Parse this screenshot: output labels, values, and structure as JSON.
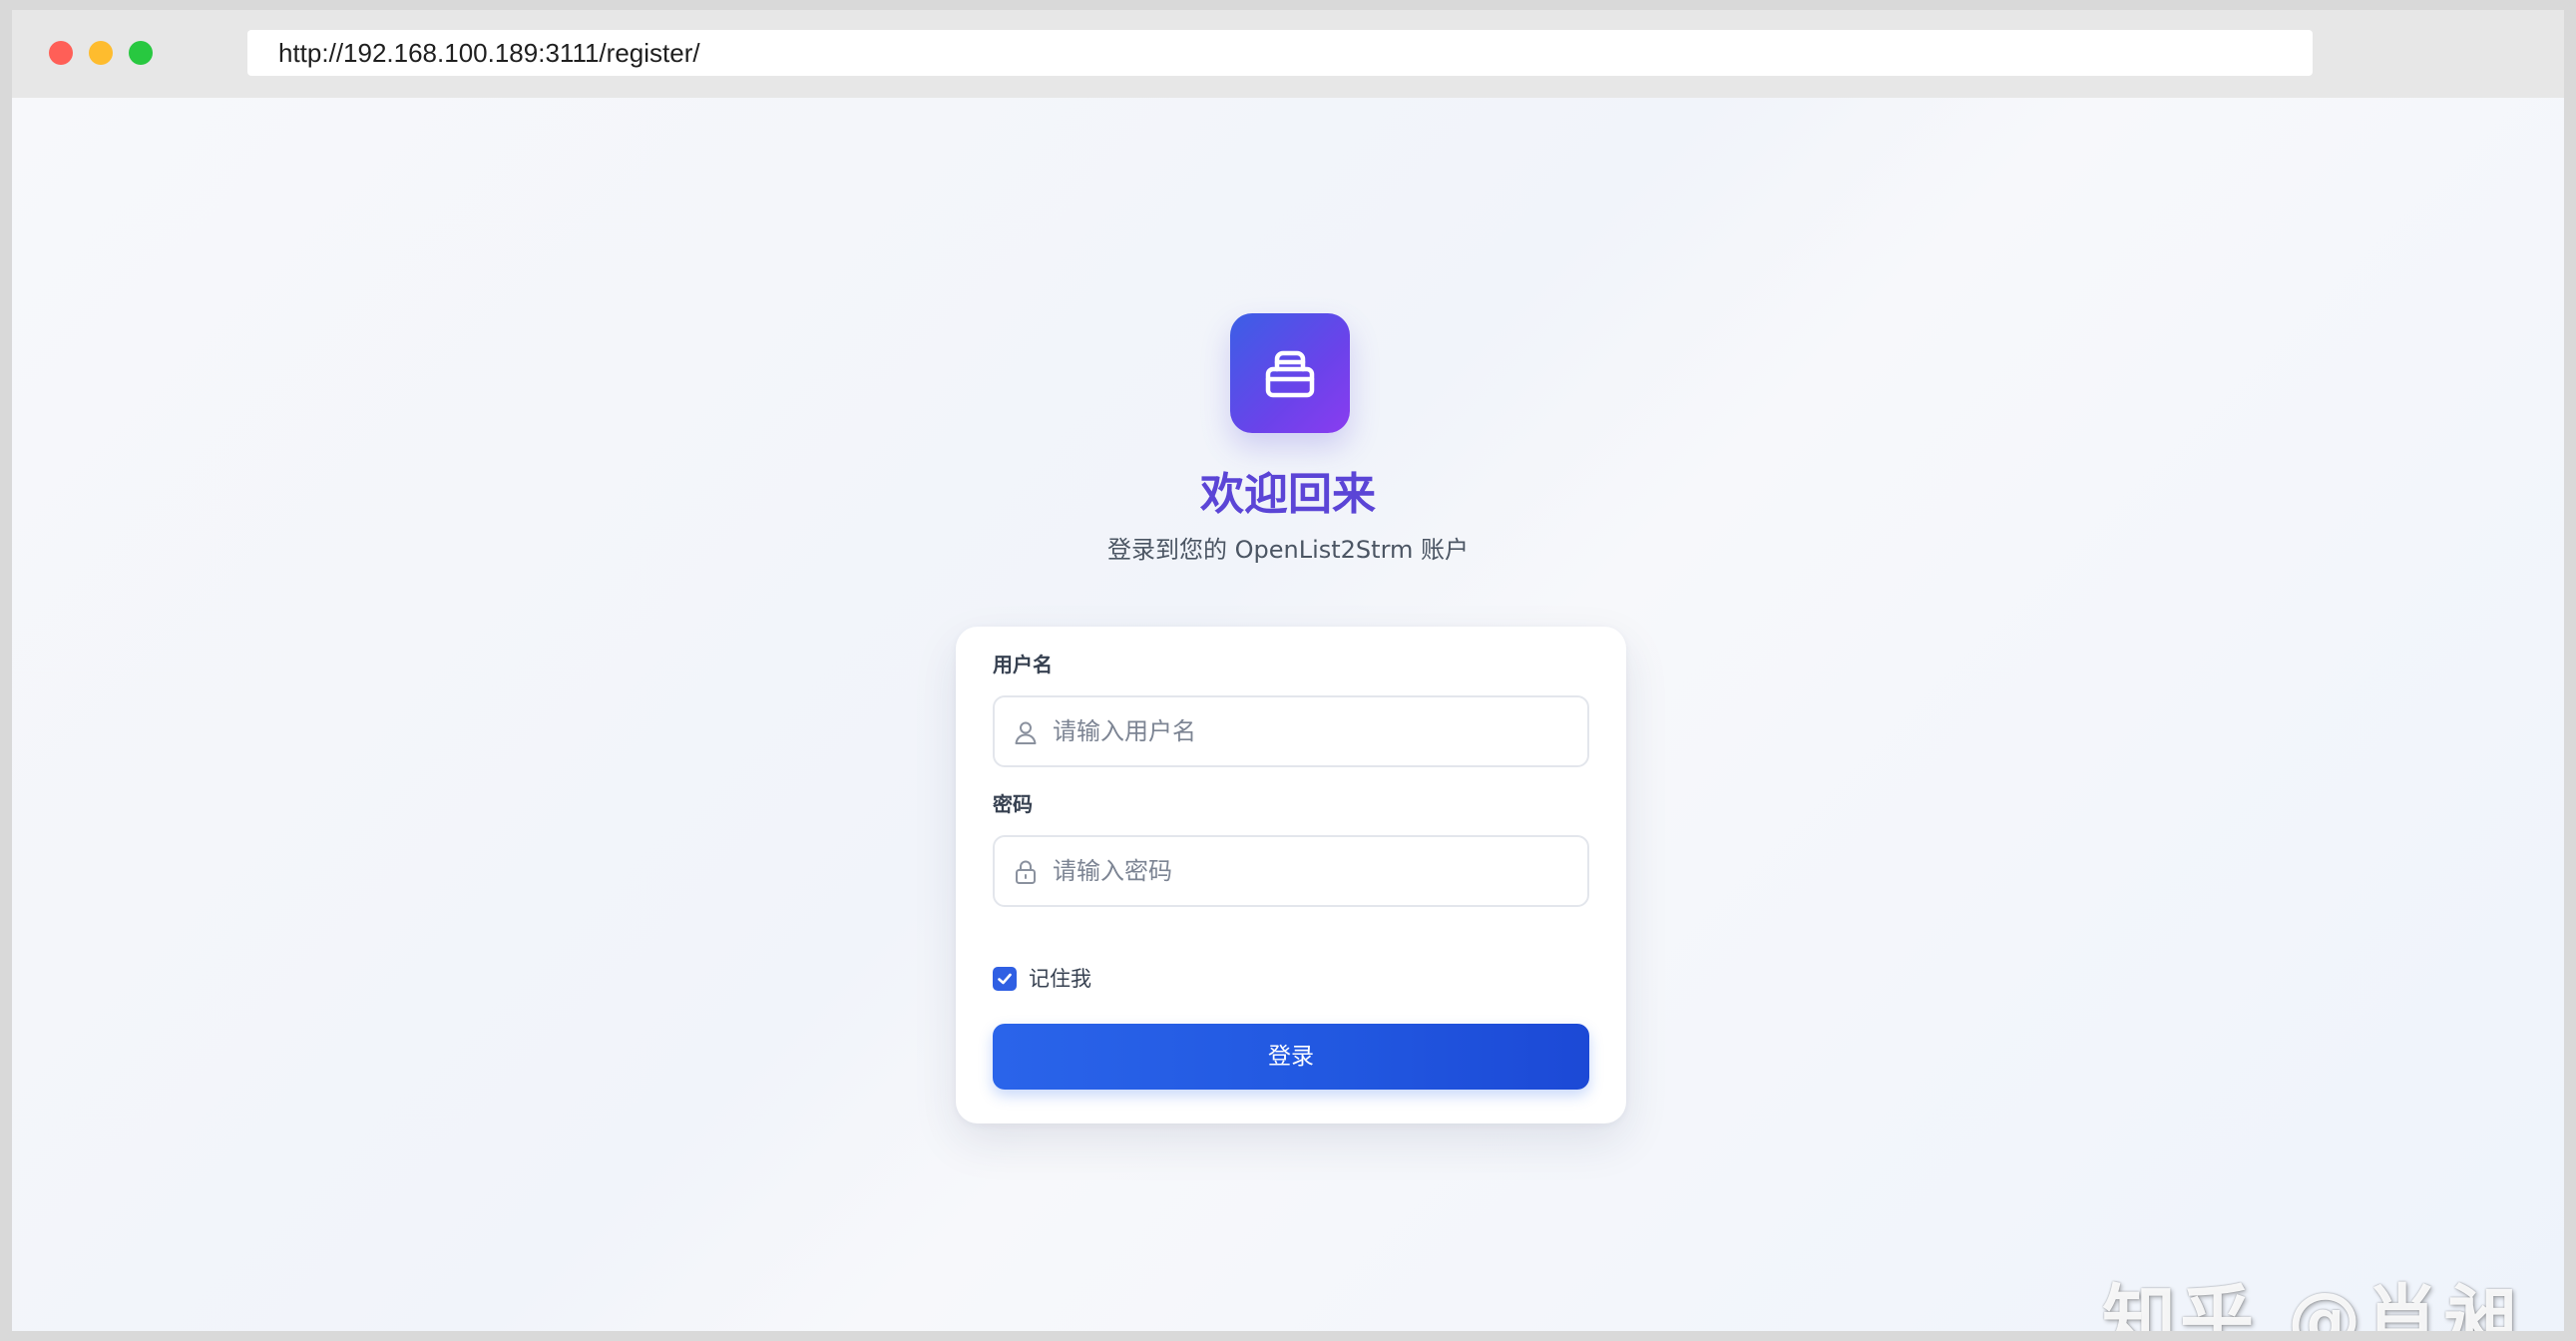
{
  "browser": {
    "url": "http://192.168.100.189:3111/register/",
    "controls": {
      "close_color": "#ff5f57",
      "minimize_color": "#febc2e",
      "maximize_color": "#28c840"
    }
  },
  "page": {
    "logo_icon": "inbox-tray-icon",
    "title": "欢迎回来",
    "subtitle": "登录到您的 OpenList2Strm 账户",
    "accent_color": "#5b45d6"
  },
  "form": {
    "username": {
      "label": "用户名",
      "value": "",
      "placeholder": "请输入用户名",
      "icon": "user-icon"
    },
    "password": {
      "label": "密码",
      "value": "",
      "placeholder": "请输入密码",
      "icon": "lock-icon"
    },
    "remember": {
      "label": "记住我",
      "checked": true
    },
    "submit_label": "登录",
    "button_color": "#2563eb"
  },
  "watermark": "知乎 @肖昶"
}
